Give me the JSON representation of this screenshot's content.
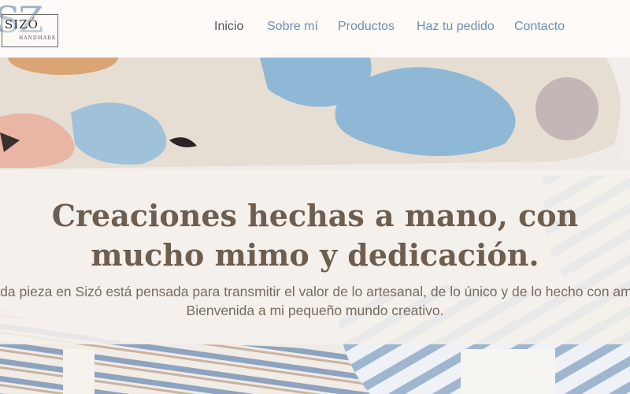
{
  "brand": {
    "logo_letters": "SZ",
    "logo_name": "SIZÓ",
    "logo_tagline": "HANDMADE"
  },
  "nav": {
    "items": [
      {
        "label": "Inicio",
        "active": true
      },
      {
        "label": "Sobre mí"
      },
      {
        "label": "Productos"
      },
      {
        "label": "Haz tu pedido"
      },
      {
        "label": "Contacto"
      }
    ]
  },
  "hero": {
    "heading": "Creaciones hechas a mano, con mucho mimo y dedicación.",
    "description_line1": "Cada pieza en Sizó está pensada para transmitir el valor de lo artesanal, de lo único y de lo hecho con amor.",
    "description_line2": "Bienvenida a mi pequeño mundo creativo."
  },
  "colors": {
    "nav_link": "#6f8fb0",
    "nav_active": "#555555",
    "heading": "#6e5e50",
    "text": "#7a6a5d"
  }
}
